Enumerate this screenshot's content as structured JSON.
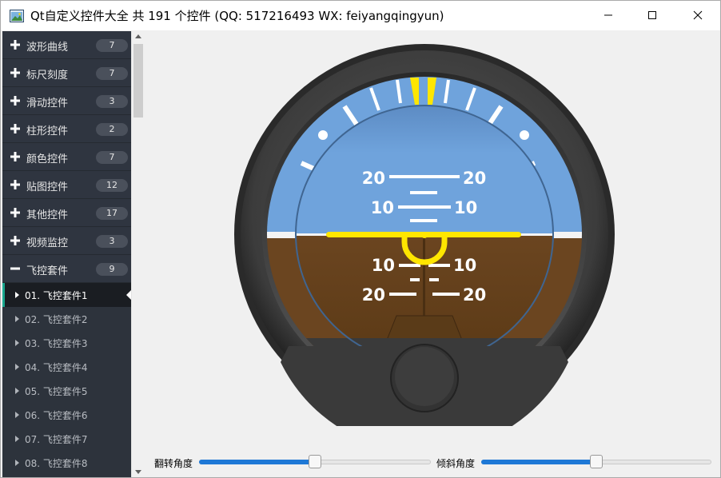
{
  "window": {
    "title": "Qt自定义控件大全 共 191 个控件 (QQ: 517216493 WX: feiyangqingyun)"
  },
  "sidebar": {
    "categories": [
      {
        "label": "波形曲线",
        "count": "7",
        "expanded": false
      },
      {
        "label": "标尺刻度",
        "count": "7",
        "expanded": false
      },
      {
        "label": "滑动控件",
        "count": "3",
        "expanded": false
      },
      {
        "label": "柱形控件",
        "count": "2",
        "expanded": false
      },
      {
        "label": "颜色控件",
        "count": "7",
        "expanded": false
      },
      {
        "label": "贴图控件",
        "count": "12",
        "expanded": false
      },
      {
        "label": "其他控件",
        "count": "17",
        "expanded": false
      },
      {
        "label": "视频监控",
        "count": "3",
        "expanded": false
      },
      {
        "label": "飞控套件",
        "count": "9",
        "expanded": true
      }
    ],
    "items": [
      {
        "label": "01. 飞控套件1",
        "active": true
      },
      {
        "label": "02. 飞控套件2",
        "active": false
      },
      {
        "label": "03. 飞控套件3",
        "active": false
      },
      {
        "label": "04. 飞控套件4",
        "active": false
      },
      {
        "label": "05. 飞控套件5",
        "active": false
      },
      {
        "label": "06. 飞控套件6",
        "active": false
      },
      {
        "label": "07. 飞控套件7",
        "active": false
      },
      {
        "label": "08. 飞控套件8",
        "active": false
      }
    ]
  },
  "attitude": {
    "pitch_labels": {
      "up20": "20",
      "up10": "10",
      "down10": "10",
      "down20": "20"
    },
    "sky_color": "#6fa3dc",
    "ground_color": "#6b4520",
    "marker_color": "#ffe600"
  },
  "controls": {
    "roll_label": "翻转角度",
    "roll_value": 0.5,
    "pitch_label": "倾斜角度",
    "pitch_value": 0.5
  },
  "colors": {
    "sidebar_bg": "#2d333c",
    "active_accent": "#19a78e",
    "slider_fill": "#1e78d6"
  }
}
